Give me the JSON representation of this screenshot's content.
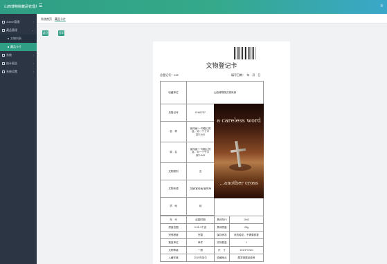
{
  "app": {
    "brand": "山西博物院藏品管理系统"
  },
  "sidebar": {
    "items": [
      {
        "label": "Admin管理",
        "icon": "grid-icon"
      },
      {
        "label": "藏品管理",
        "icon": "grid-icon"
      },
      {
        "label": "系统",
        "icon": "grid-icon"
      },
      {
        "label": "统计报告",
        "icon": "grid-icon"
      },
      {
        "label": "系统设置",
        "icon": "grid-icon"
      }
    ],
    "subitems": [
      {
        "label": "文物列表",
        "active": false
      },
      {
        "label": "藏品卡片",
        "active": true
      }
    ]
  },
  "tabs": [
    {
      "label": "系统首页",
      "active": false
    },
    {
      "label": "藏品卡片",
      "active": true
    }
  ],
  "actions": {
    "back": "返回",
    "print": "打印"
  },
  "card": {
    "title": "文物登记卡",
    "collection_no_label": "总登记号：",
    "collection_no": "132",
    "date_label": "填写日期：",
    "date_value": "年　月　日",
    "artwork_text_top": "a careless word",
    "artwork_text_bottom": "...another cross"
  },
  "table": {
    "unit_label": "收藏单位",
    "unit_value": "山西博物院文物库房",
    "reg_label": "总登记号",
    "reg_value": "FH60757",
    "name_label": "名　称",
    "name_value": "宣传画“一句粗心的话，另一个十字架”1943",
    "orig_label": "原　名",
    "orig_value": "宣传画“一句粗心的话，另一个十字架”1943",
    "category_label": "文物类别",
    "category_value": "无",
    "source_label": "文物来源",
    "source_value": "文献/宣传画/宣传海",
    "quality_label": "质　地",
    "quality_value": "纸",
    "rows": [
      [
        "年　代",
        "民国时期",
        "具体年代",
        "1943"
      ],
      [
        "质量范围",
        "0.01-1千克",
        "具体质量",
        "28g"
      ],
      [
        "完残程度",
        "完整",
        "保存状态",
        "状态稳定，不需要修复"
      ],
      [
        "数量单位",
        "单件",
        "实际数量",
        "1"
      ],
      [
        "文物等级",
        "一般",
        "尺　寸",
        "101.5*72cm"
      ],
      [
        "入藏年度",
        "2019年至今",
        "收藏地点",
        "展览馆展品库房"
      ]
    ]
  }
}
